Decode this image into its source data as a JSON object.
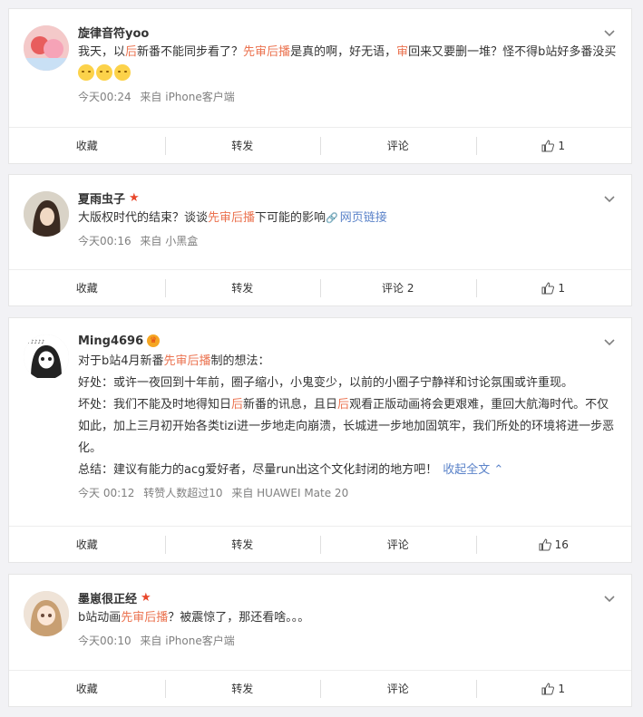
{
  "posts": [
    {
      "username": "旋律音符yoo",
      "badge": "",
      "content": [
        [
          {
            "t": "我天，以"
          },
          {
            "t": "后",
            "hl": true
          },
          {
            "t": "新番不能同步看了？"
          },
          {
            "t": "先审后播",
            "hl": true
          },
          {
            "t": "是真的啊，好无语，"
          },
          {
            "t": "审",
            "hl": true
          },
          {
            "t": "回来又要删一堆？怪不得b站好多番没买"
          },
          {
            "emoji": true
          },
          {
            "emoji": true
          },
          {
            "emoji": true
          }
        ]
      ],
      "time": "今天00:24",
      "extra": "",
      "source": "来自 iPhone客户端",
      "actions": {
        "collect": "收藏",
        "repost": "转发",
        "comment": "评论",
        "likes": "1"
      }
    },
    {
      "username": "夏雨虫子",
      "badge": "star",
      "content": [
        [
          {
            "t": "大版权时代的结束？谈谈"
          },
          {
            "t": "先审后播",
            "hl": true
          },
          {
            "t": "下可能的影响"
          },
          {
            "link": "网页链接"
          }
        ]
      ],
      "time": "今天00:16",
      "extra": "",
      "source": "来自 小黑盒",
      "actions": {
        "collect": "收藏",
        "repost": "转发",
        "comment": "评论 2",
        "likes": "1"
      }
    },
    {
      "username": "Ming4696",
      "badge": "crown",
      "content": [
        [
          {
            "t": "对于b站4月新番"
          },
          {
            "t": "先审后播",
            "hl": true
          },
          {
            "t": "制的想法："
          }
        ],
        [
          {
            "t": "好处：或许一夜回到十年前，圈子缩小，小鬼变少，以前的小圈子宁静祥和讨论氛围或许重现。"
          }
        ],
        [
          {
            "t": "坏处：我们不能及时地得知日"
          },
          {
            "t": "后",
            "hl": true
          },
          {
            "t": "新番的讯息，且日"
          },
          {
            "t": "后",
            "hl": true
          },
          {
            "t": "观看正版动画将会更艰难，重回大航海时代。不仅如此，加上三月初开始各类tizi进一步地走向崩溃，长城进一步地加固筑牢，我们所处的环境将进一步恶化。"
          }
        ],
        [
          {
            "t": "总结：建议有能力的acg爱好者，尽量run出这个文化封闭的地方吧！"
          },
          {
            "expand": "收起全文"
          }
        ]
      ],
      "time": "今天 00:12",
      "extra": "转赞人数超过10",
      "source": "来自 HUAWEI Mate 20",
      "actions": {
        "collect": "收藏",
        "repost": "转发",
        "comment": "评论",
        "likes": "16"
      }
    },
    {
      "username": "墨崽很正经",
      "badge": "star",
      "content": [
        [
          {
            "t": "b站动画"
          },
          {
            "t": "先审后播",
            "hl": true
          },
          {
            "t": "？被震惊了，那还看啥。。。"
          }
        ]
      ],
      "time": "今天00:10",
      "extra": "",
      "source": "来自 iPhone客户端",
      "actions": {
        "collect": "收藏",
        "repost": "转发",
        "comment": "评论",
        "likes": "1"
      }
    }
  ],
  "colors": {
    "highlight": "#eb7350",
    "link": "#5b83c9",
    "star": "#e8472b"
  },
  "icons": {
    "like": "thumbs-up-icon",
    "menu": "chevron-down-icon",
    "link": "link-icon",
    "expand": "chevron-up-icon"
  }
}
